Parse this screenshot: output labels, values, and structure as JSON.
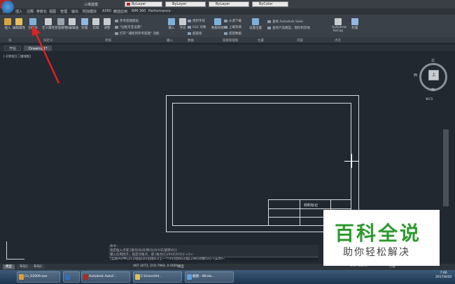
{
  "app": {
    "window_title": "三维建模",
    "quick_combo_layer": "ByLayer",
    "quick_combo_linetype": "ByLayer",
    "quick_combo_lineweight": "ByLayer",
    "quick_combo_color": "ByColor",
    "brand_color": "#b0271f"
  },
  "menu": [
    "默认",
    "插入",
    "注释",
    "参数化",
    "视图",
    "管理",
    "输出",
    "附加模块",
    "A360",
    "精选应用",
    "BIM 360",
    "Performance"
  ],
  "ribbon": {
    "buttons": [
      {
        "label": "插入",
        "icon": "insert-icon",
        "color": "#d9a441"
      },
      {
        "label": "编辑属性",
        "icon": "edit-attr-icon",
        "color": "#e6c15a"
      },
      {
        "label": "创建块",
        "icon": "create-block-icon",
        "color": "#7fb0d8"
      },
      {
        "label": "定义属性",
        "icon": "define-attr-icon",
        "color": "#c8ccd0"
      },
      {
        "label": "管理属性",
        "icon": "manage-attr-icon",
        "color": "#9aa4ae"
      },
      {
        "label": "块编辑器",
        "icon": "block-editor-icon",
        "color": "#c8ccd0"
      },
      {
        "label": "附着",
        "icon": "attach-icon",
        "color": "#8fb8e0"
      },
      {
        "label": "剪裁",
        "icon": "clip-icon",
        "color": "#c8ccd0"
      },
      {
        "label": "调整",
        "icon": "adjust-icon",
        "color": "#c8ccd0"
      },
      {
        "label": "输入",
        "icon": "import-icon",
        "color": "#7fb0d8"
      },
      {
        "label": "字段",
        "icon": "field-icon",
        "color": "#c8ccd0"
      },
      {
        "label": "数据链接",
        "icon": "data-link-icon",
        "color": "#7fb0d8"
      },
      {
        "label": "设置位置",
        "icon": "location-icon",
        "color": "#7fb0d8"
      },
      {
        "label": "Autodesk ReCap",
        "icon": "recap-icon",
        "color": "#c8ccd0"
      },
      {
        "label": "附着",
        "icon": "attach2-icon",
        "color": "#8fb8e0"
      }
    ],
    "small_items": [
      "参考底图图层",
      "*边框可变设置*",
      "打开 \"捕捉到参考底图\" 功能",
      "更新字段",
      "OLE 对象",
      "超链接",
      "从源下载",
      "上载到源",
      "提取数据",
      "查找 Autodesk Seek",
      "查找产品模型、图形和其他"
    ],
    "panels": [
      "块",
      "块定义",
      "参照",
      "输入",
      "数据",
      "链接和提取",
      "位置",
      "内容",
      "点云"
    ]
  },
  "doc_tabs": [
    {
      "label": "开始",
      "active": false
    },
    {
      "label": "Drawing1*",
      "active": true
    }
  ],
  "viewport_label": "[-][俯视][二维线框]",
  "viewcube": {
    "top": "上",
    "north": "北",
    "south": "南",
    "west": "西",
    "wcs": "WCS"
  },
  "titleblock_text": "材料标记",
  "command": {
    "history": [
      "命令：",
      "指定插入点或 [基点(B)/比例(S)/X/Y/Z/旋转(R)]:",
      "输入比例因子，指定对角点，或 [角点(C)/XYZ(XYZ)] <1>:"
    ],
    "input": "[全部(A)/中心(C)/动态(D)/范围(E)/上一个(P)/比例(S)/窗口(W)/对象(O)] <实时>:"
  },
  "layout_tabs": [
    {
      "label": "模型",
      "active": true
    },
    {
      "label": "布局1",
      "active": false
    },
    {
      "label": "布局2",
      "active": false
    }
  ],
  "status": {
    "coords": "487.3073, 219.7964, 0.0000",
    "model": "模型",
    "zoom": "1:1 / 100%",
    "units": "小数"
  },
  "taskbar": {
    "tasks": [
      {
        "label": "Cn_R2009.exe",
        "color": "#e0a030"
      },
      {
        "label": "",
        "color": "#3070c0"
      },
      {
        "label": "Autodesk AutoC...",
        "color": "#b0271f"
      },
      {
        "label": "C:\\Users\\Ad...",
        "color": "#e0c050"
      },
      {
        "label": "截图 - Windo...",
        "color": "#60a0e0"
      }
    ],
    "time": "7:46",
    "date": "2017/8/20"
  },
  "watermark": {
    "line1": "百科全说",
    "line2": "助你轻松解决"
  }
}
